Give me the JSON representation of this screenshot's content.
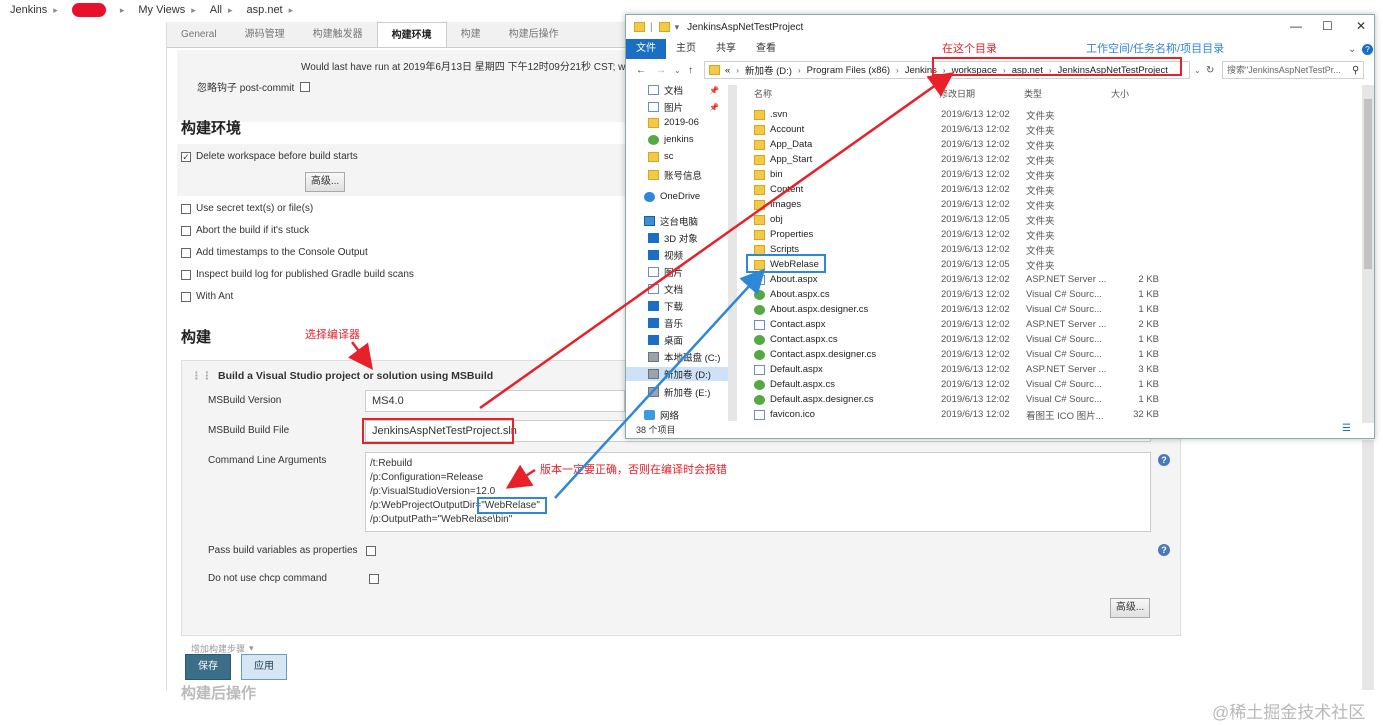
{
  "breadcrumb": [
    "Jenkins",
    "My Views",
    "All",
    "asp.net"
  ],
  "tabs": [
    {
      "label": "General"
    },
    {
      "label": "源码管理"
    },
    {
      "label": "构建触发器"
    },
    {
      "label": "构建环境",
      "active": true
    },
    {
      "label": "构建"
    },
    {
      "label": "构建后操作"
    }
  ],
  "trigger": {
    "last_run": "Would last have run at 2019年6月13日 星期四 下午12时09分21秒 CST; w",
    "ignore_hook": "忽略钩子 post-commit"
  },
  "env": {
    "title": "构建环境",
    "delete_ws": "Delete workspace before build starts",
    "advanced": "高级...",
    "options": [
      "Use secret text(s) or file(s)",
      "Abort the build if it's stuck",
      "Add timestamps to the Console Output",
      "Inspect build log for published Gradle build scans",
      "With Ant"
    ]
  },
  "build": {
    "title": "构建",
    "step_title": "Build a Visual Studio project or solution using MSBuild",
    "msbuild_version_label": "MSBuild Version",
    "msbuild_version_value": "MS4.0",
    "build_file_label": "MSBuild Build File",
    "build_file_value": "JenkinsAspNetTestProject.sln",
    "cmd_label": "Command Line Arguments",
    "cmd_lines": [
      "/t:Rebuild",
      "/p:Configuration=Release",
      "/p:VisualStudioVersion=12.0",
      "/p:WebProjectOutputDir=",
      "/p:OutputPath=\"WebRelase\\bin\""
    ],
    "cmd_highlight": "\"WebRelase\"",
    "pass_vars": "Pass build variables as properties",
    "no_chcp": "Do not use chcp command",
    "advanced": "高级...",
    "add_step": "增加构建步骤",
    "help": "?"
  },
  "post_title": "构建后操作",
  "actions": {
    "save": "保存",
    "apply": "应用"
  },
  "annotations": {
    "choose_compiler": "选择编译器",
    "version_note": "版本一定要正确，否则在编译时会报错",
    "in_this_dir": "在这个目录",
    "path_note": "工作空间/任务名称/项目目录"
  },
  "explorer": {
    "title": "JenkinsAspNetTestProject",
    "ribbon": [
      "文件",
      "主页",
      "共享",
      "查看"
    ],
    "path": [
      "«",
      "新加卷 (D:)",
      "Program Files (x86)",
      "Jenkins",
      "workspace",
      "asp.net",
      "JenkinsAspNetTestProject"
    ],
    "search_placeholder": "搜索\"JenkinsAspNetTestPr...",
    "columns": {
      "name": "名称",
      "date": "修改日期",
      "type": "类型",
      "size": "大小"
    },
    "nav": [
      {
        "label": "文档",
        "icon": "doc"
      },
      {
        "label": "图片",
        "icon": "doc"
      },
      {
        "label": "2019-06",
        "icon": "fold"
      },
      {
        "label": "jenkins",
        "icon": "green"
      },
      {
        "label": "sc",
        "icon": "fold"
      },
      {
        "label": "账号信息",
        "icon": "fold"
      },
      {
        "label": "OneDrive",
        "icon": "cloud"
      },
      {
        "label": "这台电脑",
        "icon": "pc"
      },
      {
        "label": "3D 对象",
        "icon": "blue"
      },
      {
        "label": "视频",
        "icon": "blue"
      },
      {
        "label": "图片",
        "icon": "doc"
      },
      {
        "label": "文档",
        "icon": "doc"
      },
      {
        "label": "下载",
        "icon": "blue"
      },
      {
        "label": "音乐",
        "icon": "blue"
      },
      {
        "label": "桌面",
        "icon": "blue"
      },
      {
        "label": "本地磁盘 (C:)",
        "icon": "drv"
      },
      {
        "label": "新加卷 (D:)",
        "icon": "drv",
        "selected": true
      },
      {
        "label": "新加卷 (E:)",
        "icon": "drv"
      },
      {
        "label": "网络",
        "icon": "net"
      }
    ],
    "files": [
      {
        "name": ".svn",
        "date": "2019/6/13 12:02",
        "type": "文件夹",
        "size": "",
        "icon": "fold"
      },
      {
        "name": "Account",
        "date": "2019/6/13 12:02",
        "type": "文件夹",
        "size": "",
        "icon": "fold"
      },
      {
        "name": "App_Data",
        "date": "2019/6/13 12:02",
        "type": "文件夹",
        "size": "",
        "icon": "fold"
      },
      {
        "name": "App_Start",
        "date": "2019/6/13 12:02",
        "type": "文件夹",
        "size": "",
        "icon": "fold"
      },
      {
        "name": "bin",
        "date": "2019/6/13 12:02",
        "type": "文件夹",
        "size": "",
        "icon": "fold"
      },
      {
        "name": "Content",
        "date": "2019/6/13 12:02",
        "type": "文件夹",
        "size": "",
        "icon": "fold"
      },
      {
        "name": "Images",
        "date": "2019/6/13 12:02",
        "type": "文件夹",
        "size": "",
        "icon": "fold"
      },
      {
        "name": "obj",
        "date": "2019/6/13 12:05",
        "type": "文件夹",
        "size": "",
        "icon": "fold"
      },
      {
        "name": "Properties",
        "date": "2019/6/13 12:02",
        "type": "文件夹",
        "size": "",
        "icon": "fold"
      },
      {
        "name": "Scripts",
        "date": "2019/6/13 12:02",
        "type": "文件夹",
        "size": "",
        "icon": "fold"
      },
      {
        "name": "WebRelase",
        "date": "2019/6/13 12:05",
        "type": "文件夹",
        "size": "",
        "icon": "fold"
      },
      {
        "name": "About.aspx",
        "date": "2019/6/13 12:02",
        "type": "ASP.NET Server ...",
        "size": "2 KB",
        "icon": "doc"
      },
      {
        "name": "About.aspx.cs",
        "date": "2019/6/13 12:02",
        "type": "Visual C# Sourc...",
        "size": "1 KB",
        "icon": "green"
      },
      {
        "name": "About.aspx.designer.cs",
        "date": "2019/6/13 12:02",
        "type": "Visual C# Sourc...",
        "size": "1 KB",
        "icon": "green"
      },
      {
        "name": "Contact.aspx",
        "date": "2019/6/13 12:02",
        "type": "ASP.NET Server ...",
        "size": "2 KB",
        "icon": "doc"
      },
      {
        "name": "Contact.aspx.cs",
        "date": "2019/6/13 12:02",
        "type": "Visual C# Sourc...",
        "size": "1 KB",
        "icon": "green"
      },
      {
        "name": "Contact.aspx.designer.cs",
        "date": "2019/6/13 12:02",
        "type": "Visual C# Sourc...",
        "size": "1 KB",
        "icon": "green"
      },
      {
        "name": "Default.aspx",
        "date": "2019/6/13 12:02",
        "type": "ASP.NET Server ...",
        "size": "3 KB",
        "icon": "doc"
      },
      {
        "name": "Default.aspx.cs",
        "date": "2019/6/13 12:02",
        "type": "Visual C# Sourc...",
        "size": "1 KB",
        "icon": "green"
      },
      {
        "name": "Default.aspx.designer.cs",
        "date": "2019/6/13 12:02",
        "type": "Visual C# Sourc...",
        "size": "1 KB",
        "icon": "green"
      },
      {
        "name": "favicon.ico",
        "date": "2019/6/13 12:02",
        "type": "看图王 ICO 图片...",
        "size": "32 KB",
        "icon": "doc"
      }
    ],
    "status": "38 个项目"
  },
  "watermark": "@稀土掘金技术社区"
}
